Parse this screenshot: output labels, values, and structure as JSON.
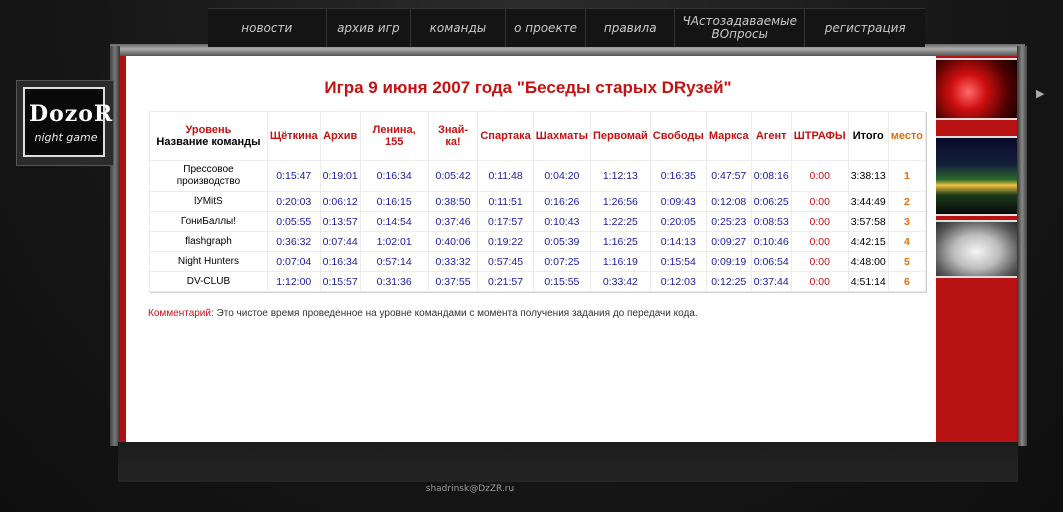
{
  "nav": {
    "items": [
      "новости",
      "архив игр",
      "команды",
      "о проекте",
      "правила",
      "ЧАстозадаваемые ВОпросы",
      "регистрация"
    ]
  },
  "logo": {
    "title": "DozoR",
    "subtitle": "night game"
  },
  "page": {
    "title": "Игра 9 июня 2007 года \"Беседы старых DRузей\""
  },
  "table": {
    "header_level": "Уровень",
    "header_team": "Название команды",
    "levels": [
      "Щёткина",
      "Архив",
      "Ленина, 155",
      "Знай-ка!",
      "Спартака",
      "Шахматы",
      "Первомай",
      "Свободы",
      "Маркса",
      "Агент"
    ],
    "fines_header": "ШТРАФЫ",
    "total_header": "Итого",
    "place_header": "место",
    "rows": [
      {
        "team": "Прессовое производство",
        "times": [
          "0:15:47",
          "0:19:01",
          "0:16:34",
          "0:05:42",
          "0:11:48",
          "0:04:20",
          "1:12:13",
          "0:16:35",
          "0:47:57",
          "0:08:16"
        ],
        "fines": "0:00",
        "total": "3:38:13",
        "place": "1"
      },
      {
        "team": "lУМitS",
        "times": [
          "0:20:03",
          "0:06:12",
          "0:16:15",
          "0:38:50",
          "0:11:51",
          "0:16:26",
          "1:26:56",
          "0:09:43",
          "0:12:08",
          "0:06:25"
        ],
        "fines": "0:00",
        "total": "3:44:49",
        "place": "2"
      },
      {
        "team": "ГониБаллы!",
        "times": [
          "0:05:55",
          "0:13:57",
          "0:14:54",
          "0:37:46",
          "0:17:57",
          "0:10:43",
          "1:22:25",
          "0:20:05",
          "0:25:23",
          "0:08:53"
        ],
        "fines": "0:00",
        "total": "3:57:58",
        "place": "3"
      },
      {
        "team": "flashgraph",
        "times": [
          "0:36:32",
          "0:07:44",
          "1:02:01",
          "0:40:06",
          "0:19:22",
          "0:05:39",
          "1:16:25",
          "0:14:13",
          "0:09:27",
          "0:10:46"
        ],
        "fines": "0:00",
        "total": "4:42:15",
        "place": "4"
      },
      {
        "team": "Night Hunters",
        "times": [
          "0:07:04",
          "0:16:34",
          "0:57:14",
          "0:33:32",
          "0:57:45",
          "0:07:25",
          "1:16:19",
          "0:15:54",
          "0:09:19",
          "0:06:54"
        ],
        "fines": "0:00",
        "total": "4:48:00",
        "place": "5"
      },
      {
        "team": "DV-CLUB",
        "times": [
          "1:12:00",
          "0:15:57",
          "0:31:36",
          "0:37:55",
          "0:21:57",
          "0:15:55",
          "0:33:42",
          "0:12:03",
          "0:12:25",
          "0:37:44"
        ],
        "fines": "0:00",
        "total": "4:51:14",
        "place": "6"
      }
    ]
  },
  "comment": {
    "label": "Комментарий:",
    "text": "Это чистое время проведенное на уровне командами с момента получения задания до передачи кода."
  },
  "footer": {
    "email": "shadrinsk@DzZR.ru"
  },
  "colors": {
    "accent": "#c41212",
    "time": "#1a1aa0",
    "place": "#e07010"
  }
}
